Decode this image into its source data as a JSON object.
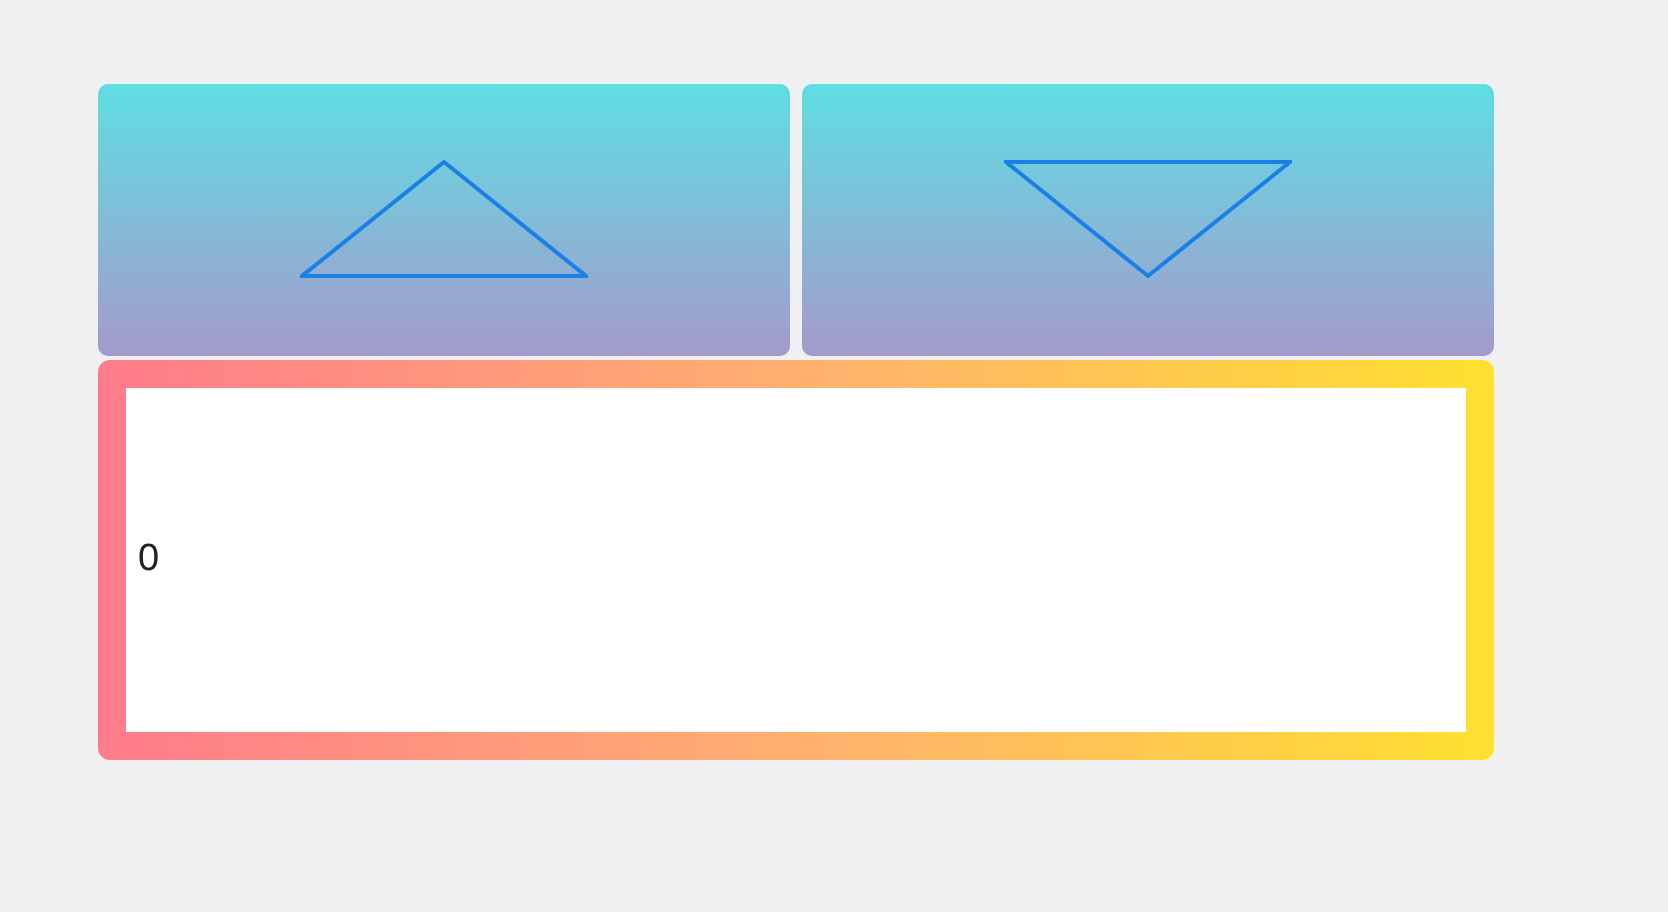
{
  "buttons": [
    {
      "kind": "up"
    },
    {
      "kind": "down"
    }
  ],
  "display": {
    "value": "0"
  }
}
